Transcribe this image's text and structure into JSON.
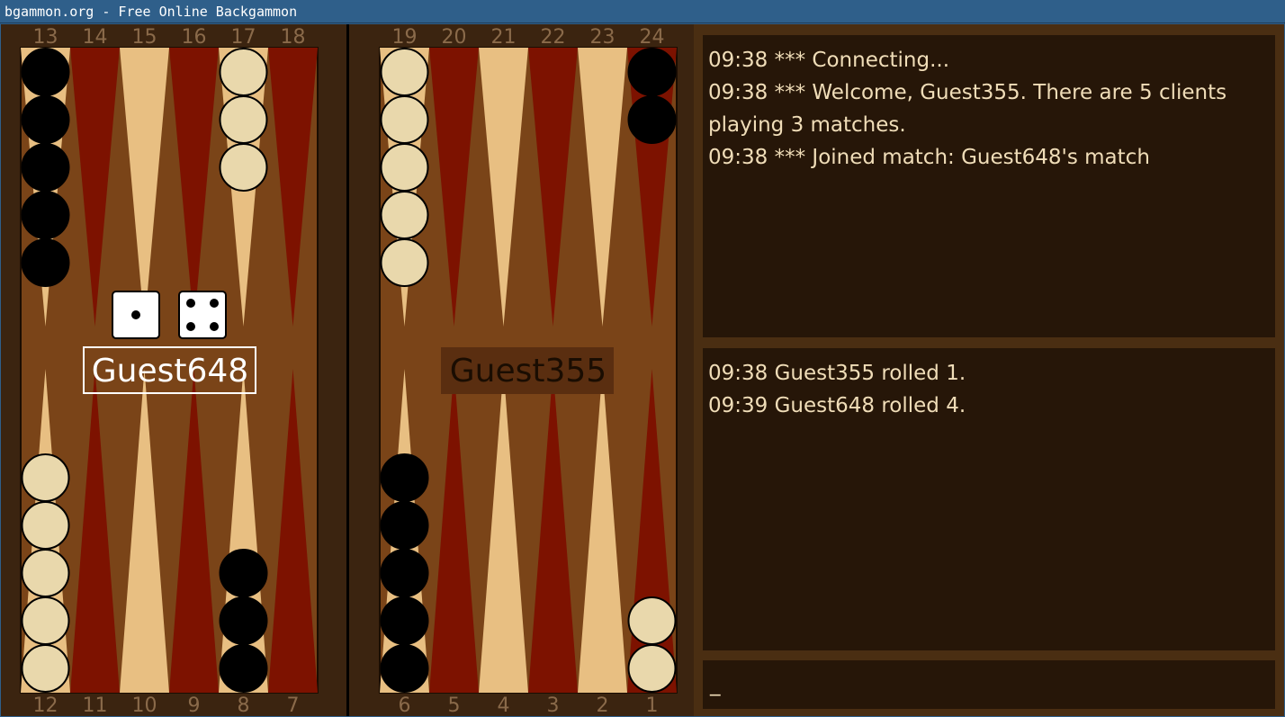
{
  "window": {
    "title": "bgammon.org - Free Online Backgammon"
  },
  "board": {
    "colors": {
      "frame": "#3b2410",
      "felt": "#7a4418",
      "triangle_red": "#7d1200",
      "triangle_tan": "#e8bf82",
      "checker_black": "#000000",
      "checker_white": "#e9d8ac",
      "label_color": "#8a6a4a"
    },
    "top_labels": [
      "13",
      "14",
      "15",
      "16",
      "17",
      "18",
      "19",
      "20",
      "21",
      "22",
      "23",
      "24"
    ],
    "bottom_labels": [
      "12",
      "11",
      "10",
      "9",
      "8",
      "7",
      "6",
      "5",
      "4",
      "3",
      "2",
      "1"
    ],
    "points": {
      "13": {
        "color": "black",
        "count": 5
      },
      "17": {
        "color": "white",
        "count": 3
      },
      "19": {
        "color": "white",
        "count": 5
      },
      "24": {
        "color": "black",
        "count": 2
      },
      "12": {
        "color": "white",
        "count": 5
      },
      "8": {
        "color": "black",
        "count": 3
      },
      "6": {
        "color": "black",
        "count": 5
      },
      "1": {
        "color": "white",
        "count": 2
      }
    },
    "dice": [
      1,
      4
    ],
    "players": {
      "left": "Guest648",
      "right": "Guest355"
    }
  },
  "server_log": [
    "09:38 *** Connecting...",
    "09:38 *** Welcome, Guest355. There are 5 clients playing 3 matches.",
    "09:38 *** Joined match: Guest648's match"
  ],
  "game_log": [
    "09:38 Guest355 rolled 1.",
    "09:39 Guest648 rolled 4."
  ],
  "chat_input": {
    "value": "_"
  }
}
